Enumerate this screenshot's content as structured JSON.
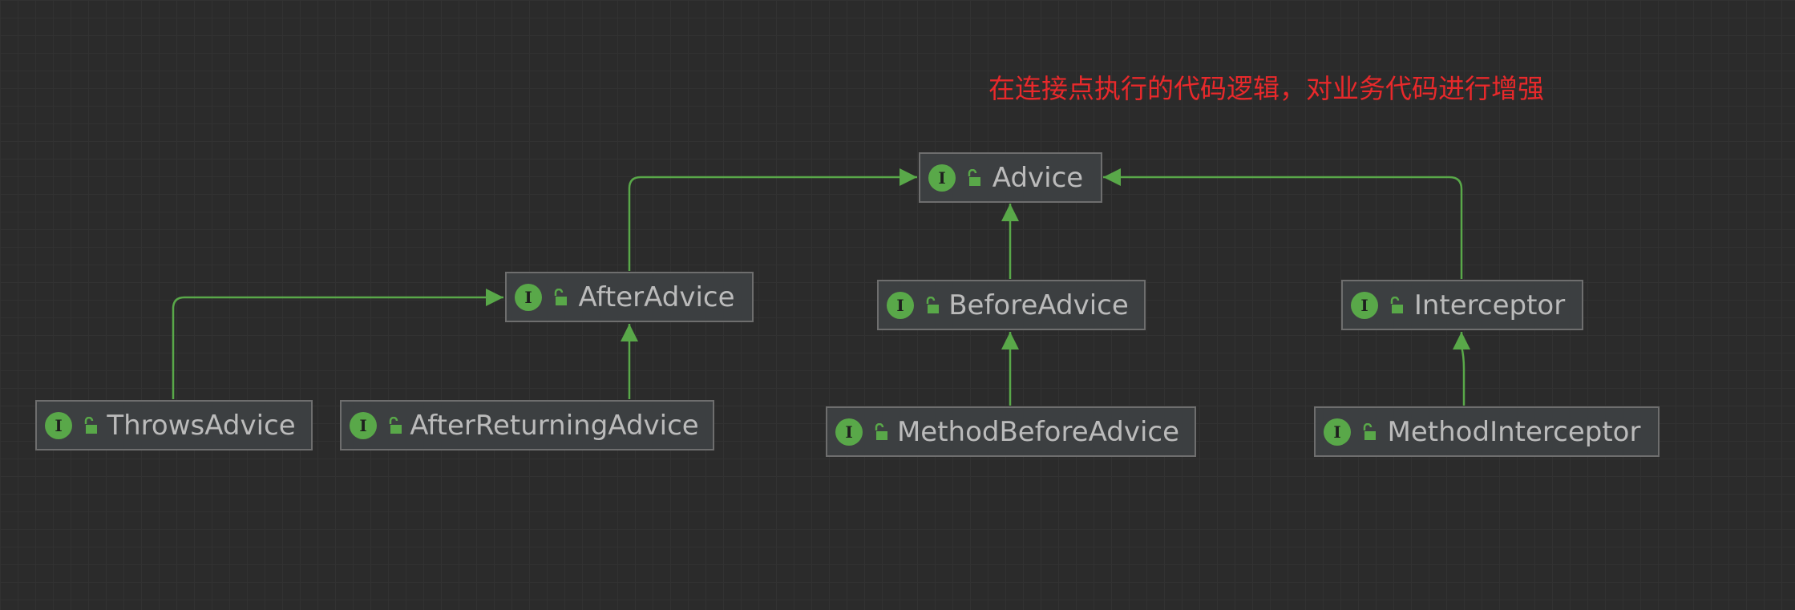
{
  "note": "在连接点执行的代码逻辑，对业务代码进行增强",
  "icons": {
    "interface": "interface-icon",
    "visibility": "public-lock-icon",
    "interface_glyph": "I"
  },
  "colors": {
    "background": "#2b2b2b",
    "node_fill": "#3c3f41",
    "node_border": "#6e6e6e",
    "node_text": "#bbbbbb",
    "edge": "#59a849",
    "interface_icon": "#59a849",
    "note_text": "#e8292b"
  },
  "nodes": {
    "advice": {
      "label": "Advice"
    },
    "after_advice": {
      "label": "AfterAdvice"
    },
    "before_advice": {
      "label": "BeforeAdvice"
    },
    "interceptor": {
      "label": "Interceptor"
    },
    "throws_advice": {
      "label": "ThrowsAdvice"
    },
    "after_returning_advice": {
      "label": "AfterReturningAdvice"
    },
    "method_before_advice": {
      "label": "MethodBeforeAdvice"
    },
    "method_interceptor": {
      "label": "MethodInterceptor"
    }
  },
  "edges": [
    {
      "from": "after_advice",
      "to": "advice",
      "relation": "extends"
    },
    {
      "from": "before_advice",
      "to": "advice",
      "relation": "extends"
    },
    {
      "from": "interceptor",
      "to": "advice",
      "relation": "extends"
    },
    {
      "from": "throws_advice",
      "to": "after_advice",
      "relation": "extends"
    },
    {
      "from": "after_returning_advice",
      "to": "after_advice",
      "relation": "extends"
    },
    {
      "from": "method_before_advice",
      "to": "before_advice",
      "relation": "extends"
    },
    {
      "from": "method_interceptor",
      "to": "interceptor",
      "relation": "extends"
    }
  ]
}
